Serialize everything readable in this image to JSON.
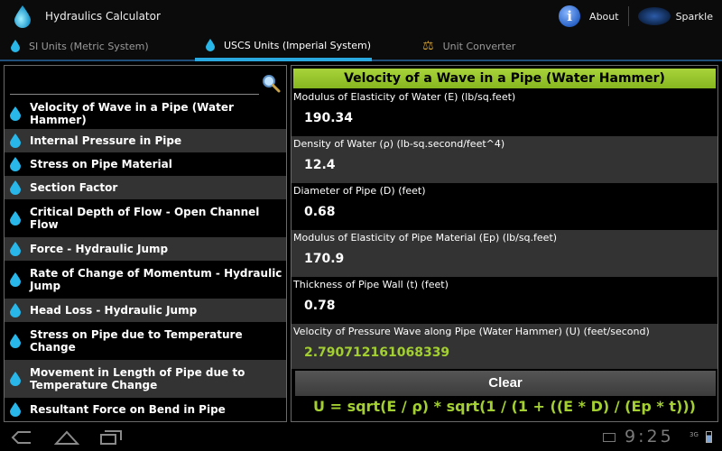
{
  "app": {
    "title": "Hydraulics Calculator"
  },
  "actionbar": {
    "about_label": "About",
    "sparkle_label": "Sparkle"
  },
  "tabs": [
    {
      "label": "SI Units (Metric System)"
    },
    {
      "label": "USCS Units (Imperial System)"
    },
    {
      "label": "Unit Converter"
    }
  ],
  "search": {
    "placeholder": ""
  },
  "sidebar": {
    "items": [
      {
        "label": "Velocity of Wave in a Pipe (Water Hammer)"
      },
      {
        "label": "Internal Pressure in Pipe"
      },
      {
        "label": "Stress on Pipe Material"
      },
      {
        "label": "Section Factor"
      },
      {
        "label": "Critical Depth of Flow - Open Channel Flow"
      },
      {
        "label": "Force - Hydraulic Jump"
      },
      {
        "label": "Rate of Change of Momentum - Hydraulic Jump"
      },
      {
        "label": "Head Loss - Hydraulic Jump"
      },
      {
        "label": "Stress on Pipe due to Temperature Change"
      },
      {
        "label": "Movement in Length of Pipe due to Temperature Change"
      },
      {
        "label": "Resultant Force on Bend in Pipe"
      }
    ]
  },
  "calculator": {
    "title": "Velocity of a Wave in a Pipe (Water Hammer)",
    "fields": [
      {
        "label": "Modulus of Elasticity of Water (E) (lb/sq.feet)",
        "value": "190.34"
      },
      {
        "label": "Density of Water (ρ) (lb-sq.second/feet^4)",
        "value": "12.4"
      },
      {
        "label": "Diameter of Pipe (D) (feet)",
        "value": "0.68"
      },
      {
        "label": "Modulus of Elasticity of Pipe Material (Ep) (lb/sq.feet)",
        "value": "170.9"
      },
      {
        "label": "Thickness of Pipe Wall (t) (feet)",
        "value": "0.78"
      },
      {
        "label": "Velocity of Pressure Wave along Pipe (Water Hammer) (U) (feet/second)",
        "value": "2.790712161068339"
      }
    ],
    "clear_label": "Clear",
    "formula": "U = sqrt(E / ρ) * sqrt(1 / (1 + ((E * D) / (Ep * t)))"
  },
  "statusbar": {
    "time": "9:25",
    "signal": "3G"
  },
  "colors": {
    "accent": "#a3cf32",
    "tab_indicator": "#2aa8e0",
    "drop": "#29b6e8"
  }
}
